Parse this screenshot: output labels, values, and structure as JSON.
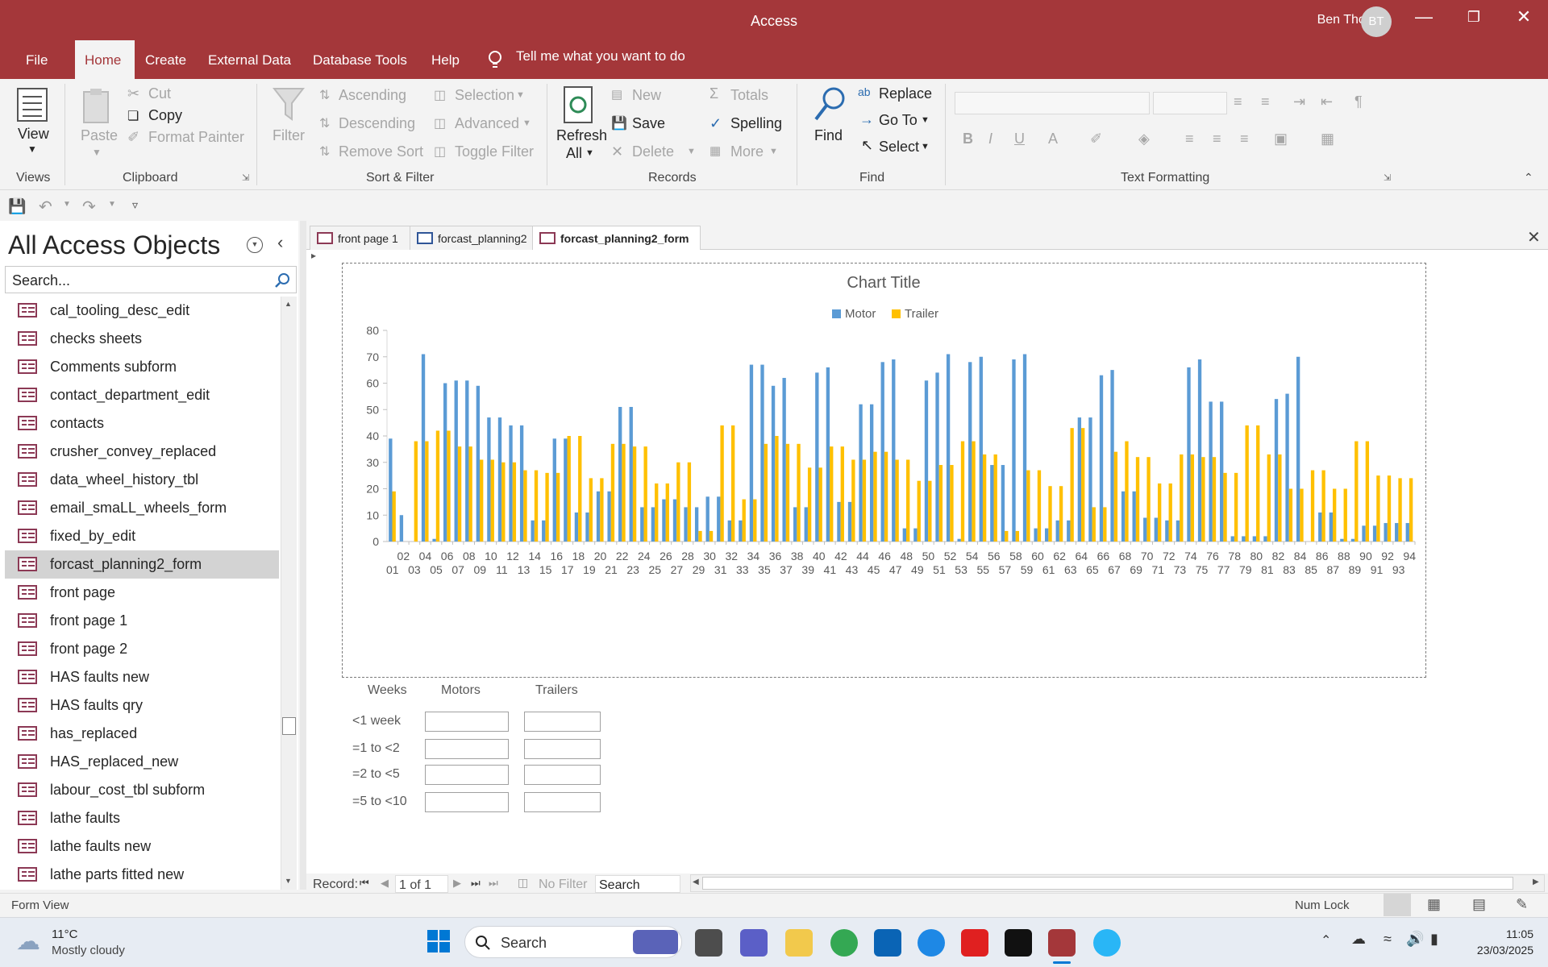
{
  "window": {
    "title": "Access",
    "user": "Ben Thomas",
    "avatar": "BT"
  },
  "menu_tabs": [
    "File",
    "Home",
    "Create",
    "External Data",
    "Database Tools",
    "Help"
  ],
  "tell_me": "Tell me what you want to do",
  "ribbon": {
    "views": {
      "view": "View",
      "group": "Views"
    },
    "clipboard": {
      "paste": "Paste",
      "cut": "Cut",
      "copy": "Copy",
      "format_painter": "Format Painter",
      "group": "Clipboard"
    },
    "sort_filter": {
      "filter": "Filter",
      "ascending": "Ascending",
      "descending": "Descending",
      "remove_sort": "Remove Sort",
      "selection": "Selection",
      "advanced": "Advanced",
      "toggle_filter": "Toggle Filter",
      "group": "Sort & Filter"
    },
    "records": {
      "refresh": "Refresh",
      "all": "All",
      "new": "New",
      "save": "Save",
      "delete": "Delete",
      "totals": "Totals",
      "spelling": "Spelling",
      "more": "More",
      "group": "Records"
    },
    "find": {
      "find": "Find",
      "replace": "Replace",
      "goto": "Go To",
      "select": "Select",
      "group": "Find"
    },
    "text_formatting": {
      "group": "Text Formatting",
      "bold": "B",
      "italic": "I",
      "underline": "U",
      "font_color": "A"
    }
  },
  "nav": {
    "title": "All Access Objects",
    "search_placeholder": "Search...",
    "items": [
      "cal_tooling_desc_edit",
      "checks sheets",
      "Comments subform",
      "contact_department_edit",
      "contacts",
      "crusher_convey_replaced",
      "data_wheel_history_tbl",
      "email_smaLL_wheels_form",
      "fixed_by_edit",
      "forcast_planning2_form",
      "front page",
      "front page 1",
      "front page 2",
      "HAS faults new",
      "HAS faults qry",
      "has_replaced",
      "HAS_replaced_new",
      "labour_cost_tbl subform",
      "lathe faults",
      "lathe faults new",
      "lathe parts fitted new"
    ],
    "selected": "forcast_planning2_form"
  },
  "doc_tabs": [
    "front page 1",
    "forcast_planning2",
    "forcast_planning2_form"
  ],
  "form": {
    "table_headers": [
      "Weeks",
      "Motors",
      "Trailers"
    ],
    "rows": [
      "<1 week",
      "=1 to <2",
      "=2 to <5",
      "=5 to <10"
    ]
  },
  "record_nav": {
    "label": "Record:",
    "position": "1 of 1",
    "filter": "No Filter",
    "search": "Search"
  },
  "status": {
    "view": "Form View",
    "numlock": "Num Lock"
  },
  "taskbar": {
    "weather_temp": "11°C",
    "weather_desc": "Mostly cloudy",
    "search": "Search",
    "time": "11:05",
    "date": "23/03/2025"
  },
  "colors": {
    "accent": "#a4373a",
    "motor": "#5b9bd5",
    "trailer": "#ffc000"
  },
  "chart_data": {
    "type": "bar",
    "title": "Chart Title",
    "legend": "top",
    "ylim": [
      0,
      80
    ],
    "yticks": [
      0,
      10,
      20,
      30,
      40,
      50,
      60,
      70,
      80
    ],
    "categories": [
      "01",
      "02",
      "03",
      "04",
      "05",
      "06",
      "07",
      "08",
      "09",
      "10",
      "11",
      "12",
      "13",
      "14",
      "15",
      "16",
      "17",
      "18",
      "19",
      "20",
      "21",
      "22",
      "23",
      "24",
      "25",
      "26",
      "27",
      "28",
      "29",
      "30",
      "31",
      "32",
      "33",
      "34",
      "35",
      "36",
      "37",
      "38",
      "39",
      "40",
      "41",
      "42",
      "43",
      "44",
      "45",
      "46",
      "47",
      "48",
      "49",
      "50",
      "51",
      "52",
      "53",
      "54",
      "55",
      "56",
      "57",
      "58",
      "59",
      "60",
      "61",
      "62",
      "63",
      "64",
      "65",
      "66",
      "67",
      "68",
      "69",
      "70",
      "71",
      "72",
      "73",
      "74",
      "75",
      "76",
      "77",
      "78",
      "79",
      "80",
      "81",
      "82",
      "83",
      "84",
      "85",
      "86",
      "87",
      "88",
      "89",
      "90",
      "91",
      "92",
      "93",
      "94"
    ],
    "series": [
      {
        "name": "Motor",
        "values": [
          39,
          10,
          0,
          71,
          1,
          60,
          61,
          61,
          59,
          47,
          47,
          44,
          44,
          8,
          8,
          39,
          39,
          11,
          11,
          19,
          19,
          51,
          51,
          13,
          13,
          16,
          16,
          13,
          13,
          17,
          17,
          8,
          8,
          67,
          67,
          59,
          62,
          13,
          13,
          64,
          66,
          15,
          15,
          52,
          52,
          68,
          69,
          5,
          5,
          61,
          64,
          71,
          1,
          68,
          70,
          29,
          29,
          69,
          71,
          5,
          5,
          8,
          8,
          47,
          47,
          63,
          65,
          19,
          19,
          9,
          9,
          8,
          8,
          66,
          69,
          53,
          53,
          2,
          2,
          2,
          2,
          54,
          56,
          70,
          0,
          11,
          11,
          1,
          1,
          6,
          6,
          7,
          7,
          7
        ]
      },
      {
        "name": "Trailer",
        "values": [
          19,
          0,
          38,
          38,
          42,
          42,
          36,
          36,
          31,
          31,
          30,
          30,
          27,
          27,
          26,
          26,
          40,
          40,
          24,
          24,
          37,
          37,
          36,
          36,
          22,
          22,
          30,
          30,
          4,
          4,
          44,
          44,
          16,
          16,
          37,
          40,
          37,
          37,
          28,
          28,
          36,
          36,
          31,
          31,
          34,
          34,
          31,
          31,
          23,
          23,
          29,
          29,
          38,
          38,
          33,
          33,
          4,
          4,
          27,
          27,
          21,
          21,
          43,
          43,
          13,
          13,
          34,
          38,
          32,
          32,
          22,
          22,
          33,
          33,
          32,
          32,
          26,
          26,
          44,
          44,
          33,
          33,
          20,
          20,
          27,
          27,
          20,
          20,
          38,
          38,
          25,
          25,
          24,
          24
        ]
      }
    ]
  }
}
